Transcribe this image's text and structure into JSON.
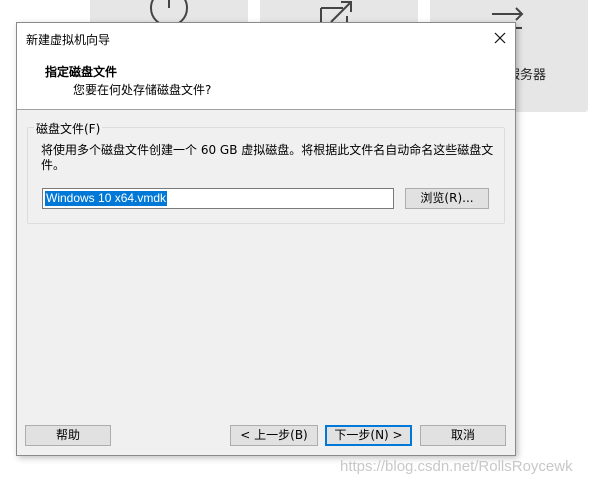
{
  "background": {
    "tile3_label": "理服务器"
  },
  "dialog": {
    "title": "新建虚拟机向导",
    "header_title": "指定磁盘文件",
    "header_subtitle": "您要在何处存储磁盘文件?",
    "group_label": "磁盘文件(F)",
    "group_desc": "将使用多个磁盘文件创建一个 60 GB 虚拟磁盘。将根据此文件名自动命名这些磁盘文件。",
    "file_value": "Windows 10 x64.vmdk",
    "browse_label": "浏览(R)...",
    "help_label": "帮助",
    "back_label": "< 上一步(B)",
    "next_label": "下一步(N) >",
    "cancel_label": "取消"
  },
  "watermark": "https://blog.csdn.net/RollsRoycewk",
  "colors": {
    "selection": "#0078d7",
    "dialog_bg": "#f0f0f0",
    "tile_bg": "#e6e6e6"
  }
}
